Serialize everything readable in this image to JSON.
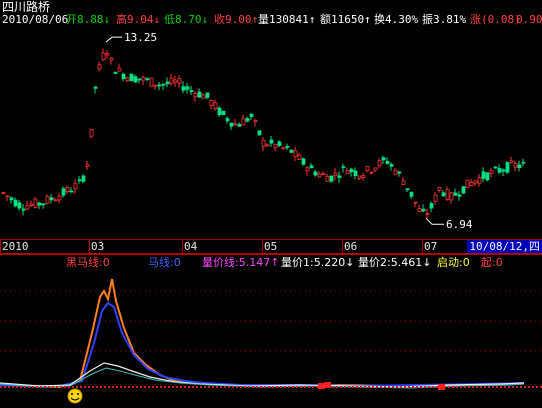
{
  "header": {
    "title": "四川路桥",
    "date": "2010/08/06",
    "fields": [
      {
        "label": "开",
        "value": "8.88",
        "arrow": "↓",
        "color": "#00d000"
      },
      {
        "label": "高",
        "value": "9.04",
        "arrow": "↓",
        "color": "#ff4040"
      },
      {
        "label": "低",
        "value": "8.70",
        "arrow": "↓",
        "color": "#00d000"
      },
      {
        "label": "收",
        "value": "9.00",
        "arrow": "↑",
        "color": "#ff4040"
      },
      {
        "label": "量",
        "value": "130841",
        "arrow": "↑",
        "color": "#ffffff"
      },
      {
        "label": "额",
        "value": "11650",
        "arrow": "↑",
        "color": "#ffffff"
      },
      {
        "label": "换",
        "value": "4.30%",
        "arrow": "",
        "color": "#ffffff"
      },
      {
        "label": "振",
        "value": "3.81%",
        "arrow": "",
        "color": "#ffffff"
      },
      {
        "label": "涨",
        "value": "(0.08)",
        "arrow": "",
        "color": "#ff4040"
      },
      {
        "label": "",
        "value": "0.90",
        "arrow": "",
        "color": "#ff4040"
      }
    ]
  },
  "price_chart": {
    "high_label": "13.25",
    "low_label": "6.94",
    "colors": {
      "up": "#ff3030",
      "down": "#00e080",
      "background": "#000000",
      "label": "#ffffff"
    }
  },
  "date_axis": {
    "labels": [
      "2010",
      "03",
      "04",
      "05",
      "06",
      "07"
    ],
    "current": "10/08/12,四"
  },
  "indicator": {
    "legend": [
      {
        "text": "黑马线:0",
        "color": "#ff4040"
      },
      {
        "text": "马线:0",
        "color": "#4060ff"
      },
      {
        "text": "量价线:5.147↑",
        "color": "#ff40ff"
      },
      {
        "text": "量价1:5.220↓",
        "color": "#ffffff"
      },
      {
        "text": "量价2:5.461↓",
        "color": "#ffffff"
      },
      {
        "text": "启动:0",
        "color": "#ffff40"
      },
      {
        "text": "起:0",
        "color": "#ff4040"
      }
    ],
    "colors": {
      "orange": "#ff8020",
      "blue": "#3040ff",
      "white": "#f0f0f0",
      "cyan": "#40c0c0",
      "marker": "#ff2020"
    }
  }
}
